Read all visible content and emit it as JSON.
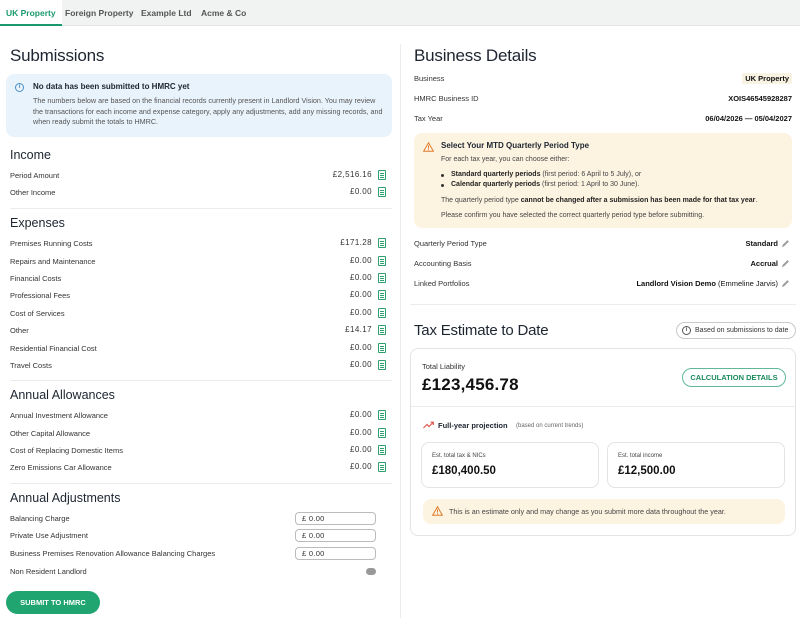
{
  "tabs": [
    "UK Property",
    "Foreign Property",
    "Example Ltd",
    "Acme & Co"
  ],
  "submissions": {
    "title": "Submissions",
    "info": {
      "title": "No data has been submitted to HMRC yet",
      "body": "The numbers below are based on the financial records currently present in Landlord Vision. You may review the transactions for each income and expense category, apply any adjustments, add any missing records, and when ready submit the totals to HMRC."
    },
    "income": {
      "heading": "Income",
      "rows": [
        {
          "label": "Period Amount",
          "value": "£2,516.16"
        },
        {
          "label": "Other Income",
          "value": "£0.00"
        }
      ]
    },
    "expenses": {
      "heading": "Expenses",
      "rows": [
        {
          "label": "Premises Running Costs",
          "value": "£171.28"
        },
        {
          "label": "Repairs and Maintenance",
          "value": "£0.00"
        },
        {
          "label": "Financial Costs",
          "value": "£0.00"
        },
        {
          "label": "Professional Fees",
          "value": "£0.00"
        },
        {
          "label": "Cost of Services",
          "value": "£0.00"
        },
        {
          "label": "Other",
          "value": "£14.17"
        },
        {
          "label": "Residential Financial Cost",
          "value": "£0.00"
        },
        {
          "label": "Travel Costs",
          "value": "£0.00"
        }
      ]
    },
    "allowances": {
      "heading": "Annual Allowances",
      "rows": [
        {
          "label": "Annual Investment Allowance",
          "value": "£0.00"
        },
        {
          "label": "Other Capital Allowance",
          "value": "£0.00"
        },
        {
          "label": "Cost of Replacing Domestic Items",
          "value": "£0.00"
        },
        {
          "label": "Zero Emissions Car Allowance",
          "value": "£0.00"
        }
      ]
    },
    "adjustments": {
      "heading": "Annual Adjustments",
      "rows": [
        {
          "label": "Balancing Charge",
          "value": "£  0.00"
        },
        {
          "label": "Private Use Adjustment",
          "value": "£  0.00"
        },
        {
          "label": "Business Premises Renovation Allowance Balancing Charges",
          "value": "£  0.00"
        },
        {
          "label": "Non Resident Landlord",
          "toggle": false
        }
      ]
    },
    "submit_label": "SUBMIT TO HMRC"
  },
  "business": {
    "title": "Business Details",
    "rows": [
      {
        "label": "Business",
        "value": "UK Property"
      },
      {
        "label": "HMRC Business ID",
        "value": "XOIS46545928287"
      },
      {
        "label": "Tax Year",
        "value": "06/04/2026 — 05/04/2027"
      }
    ],
    "mtd": {
      "title": "Select Your MTD Quarterly Period Type",
      "intro": "For each tax year, you can choose either:",
      "b1_bold": "Standard quarterly periods",
      "b1_rest": " (first period: 6 April to 5 July), or",
      "b2_bold": "Calendar quarterly periods",
      "b2_rest": " (first period: 1 April to 30 June).",
      "note_pre": "The quarterly period type ",
      "note_bold": "cannot be changed after a submission has been made for that tax year",
      "note_post": ".",
      "confirm": "Please confirm you have selected the correct quarterly period type before submitting."
    },
    "settings": [
      {
        "label": "Quarterly Period Type",
        "value": "Standard"
      },
      {
        "label": "Accounting Basis",
        "value": "Accrual"
      },
      {
        "label": "Linked Portfolios",
        "value": "Landlord Vision Demo",
        "extra": " (Emmeline Jarvis)"
      }
    ]
  },
  "estimate": {
    "title": "Tax Estimate to Date",
    "chip": "Based on submissions to date",
    "total_label": "Total Liability",
    "total_value": "£123,456.78",
    "calc_button": "CALCULATION DETAILS",
    "projection_title": "Full-year projection",
    "projection_sub": "(based on current trends)",
    "tax_label": "Est. total tax & NICs",
    "tax_value": "£180,400.50",
    "income_label": "Est. total income",
    "income_value": "£12,500.00",
    "warning": "This is an estimate only and may change as you submit more data throughout the year."
  },
  "colors": {
    "accent": "#20a571",
    "info_bg": "#e9f3fb",
    "warn_bg": "#fdf3e1",
    "warn_icon": "#e07a2a"
  }
}
